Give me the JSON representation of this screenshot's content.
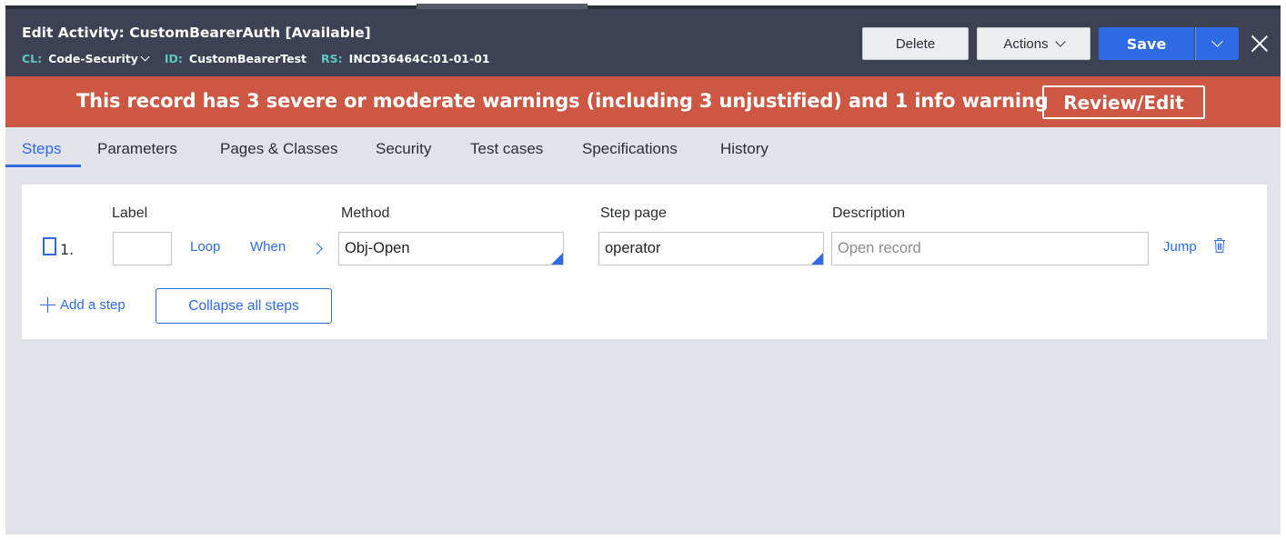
{
  "header": {
    "title": "Edit  Activity: CustomBearerAuth [Available]",
    "cl_key": "CL:",
    "cl_value": "Code-Security",
    "id_key": "ID:",
    "id_value": "CustomBearerTest",
    "rs_key": "RS:",
    "rs_value": "INCD36464C:01-01-01",
    "delete_label": "Delete",
    "actions_label": "Actions",
    "save_label": "Save"
  },
  "warning": {
    "text": "This record has 3 severe or moderate warnings (including 3 unjustified) and 1 info warning",
    "review_label": "Review/Edit"
  },
  "tabs": [
    {
      "label": "Steps",
      "active": true
    },
    {
      "label": "Parameters"
    },
    {
      "label": "Pages & Classes"
    },
    {
      "label": "Security"
    },
    {
      "label": "Test cases"
    },
    {
      "label": "Specifications"
    },
    {
      "label": "History"
    }
  ],
  "steps": {
    "columns": {
      "label": "Label",
      "method": "Method",
      "step_page": "Step page",
      "description": "Description"
    },
    "rows": [
      {
        "number": "1.",
        "label_value": "",
        "loop_label": "Loop",
        "when_label": "When",
        "method": "Obj-Open",
        "step_page": "operator",
        "description_placeholder": "Open record",
        "jump_label": "Jump"
      }
    ],
    "add_step_label": "Add a step",
    "collapse_label": "Collapse all steps"
  },
  "colors": {
    "header_bg": "#3d4153",
    "warning_bg": "#cc5844",
    "accent": "#2d6ae3",
    "content_bg": "#e2e3e8"
  }
}
